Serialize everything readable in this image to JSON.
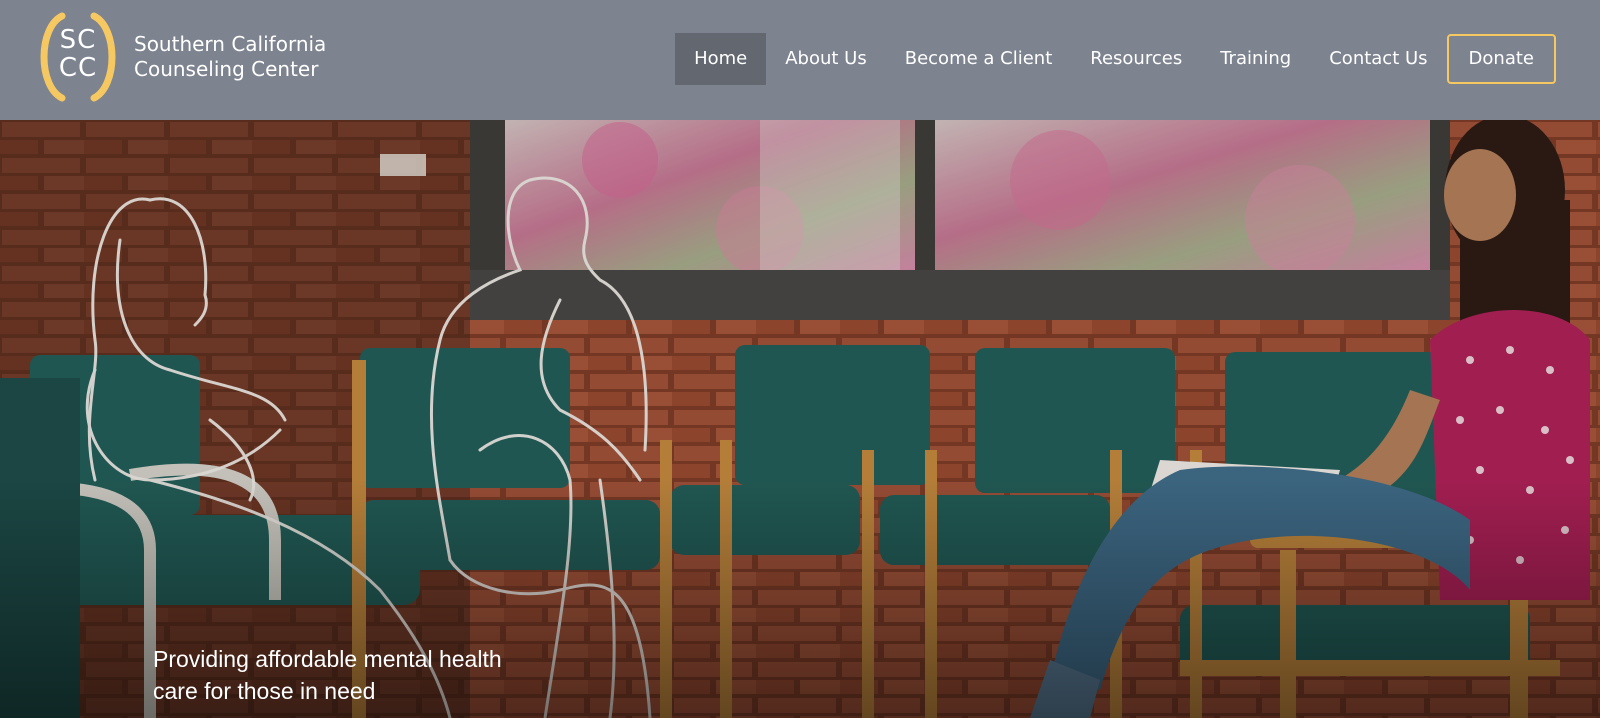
{
  "brand": {
    "initials_top": "SC",
    "initials_bottom": "CC",
    "name_line1": "Southern California",
    "name_line2": "Counseling Center",
    "accent_color": "#f6c862"
  },
  "nav": {
    "items": [
      {
        "label": "Home",
        "active": true
      },
      {
        "label": "About Us"
      },
      {
        "label": "Become a Client"
      },
      {
        "label": "Resources"
      },
      {
        "label": "Training"
      },
      {
        "label": "Contact Us"
      }
    ],
    "donate_label": "Donate"
  },
  "hero": {
    "tagline_line1": "Providing affordable mental health",
    "tagline_line2": "care for those in need",
    "image": "counseling-waiting-room-photo"
  },
  "colors": {
    "header_bg": "#7d838f",
    "active_nav_bg": "#626770",
    "chair_green": "#1f5f5a",
    "brick": "#9a4a31"
  }
}
